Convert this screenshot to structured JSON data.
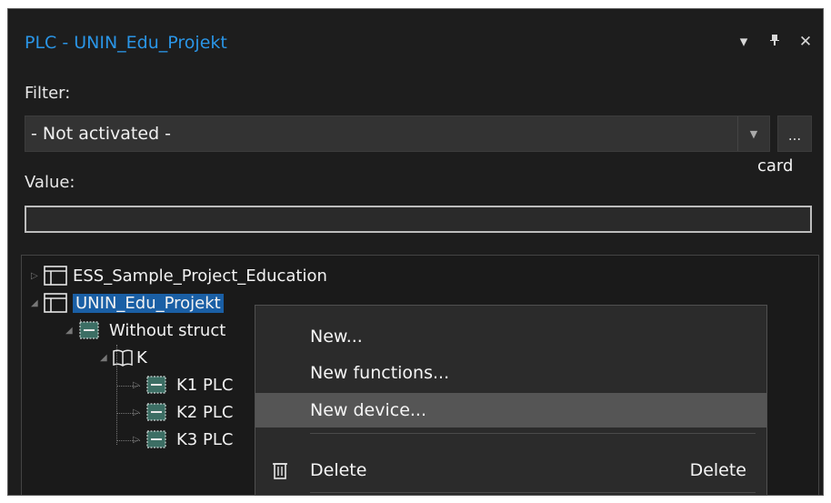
{
  "panel": {
    "title": "PLC - UNIN_Edu_Projekt",
    "controls": [
      "▾",
      "ₚ",
      "✕"
    ]
  },
  "filter": {
    "label": "Filter:",
    "selected": "- Not activated -",
    "dots_label": "..."
  },
  "value": {
    "label": "Value:",
    "input_value": ""
  },
  "tree": {
    "nodes": [
      {
        "label": "ESS_Sample_Project_Education"
      },
      {
        "label": "UNIN_Edu_Projekt"
      },
      {
        "label": "Without struct"
      },
      {
        "label": "K"
      },
      {
        "label": "K1 PLC"
      },
      {
        "label": "K2 PLC"
      },
      {
        "label": "K3 PLC"
      }
    ],
    "overflow_text": "card"
  },
  "context_menu": {
    "items": [
      {
        "label": "New..."
      },
      {
        "label": "New functions..."
      },
      {
        "label": "New device..."
      },
      {
        "label": "Delete",
        "shortcut": "Delete"
      }
    ]
  }
}
